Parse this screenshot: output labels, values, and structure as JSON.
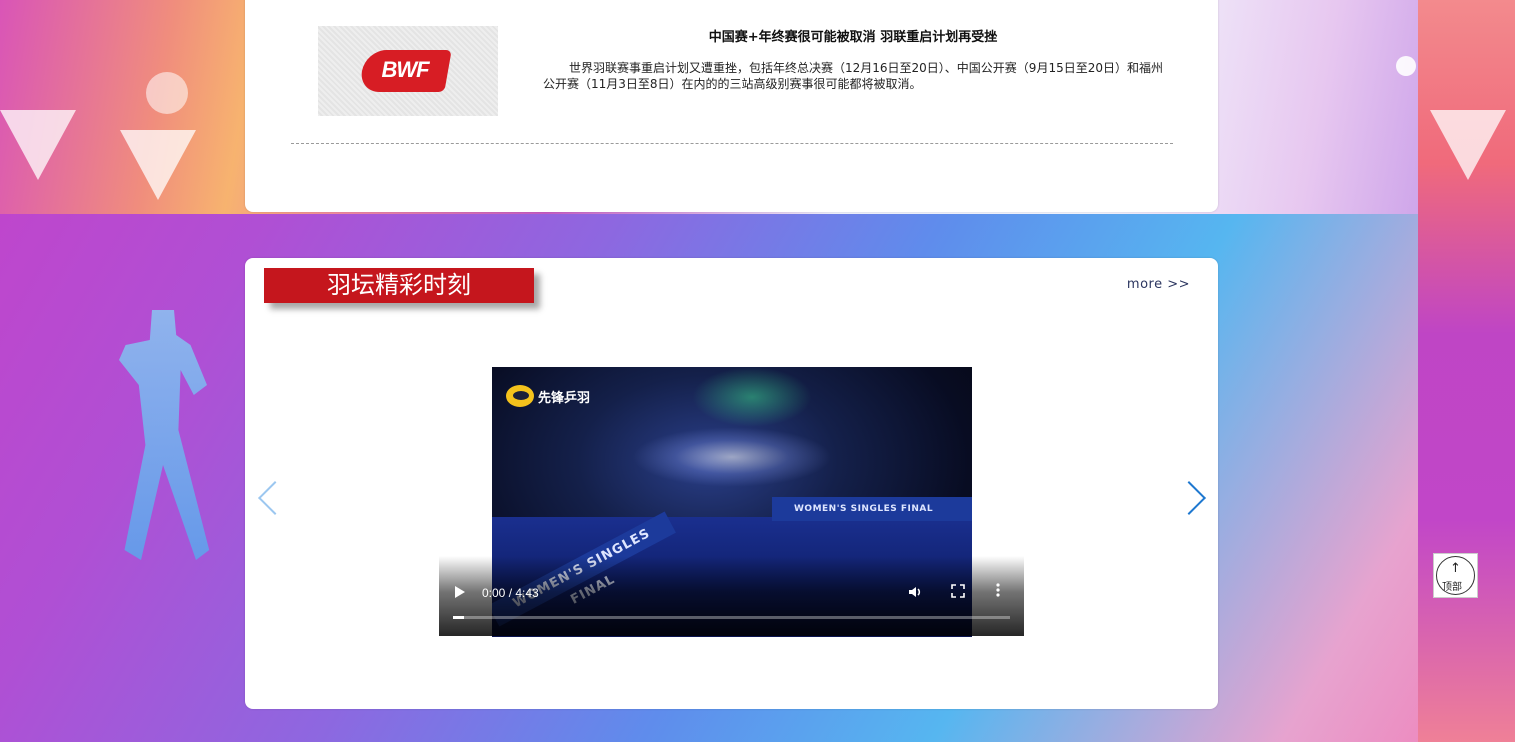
{
  "news": {
    "thumbnail_logo_text": "BWF",
    "title": "中国赛+年终赛很可能被取消 羽联重启计划再受挫",
    "summary": "世界羽联赛事重启计划又遭重挫，包括年终总决赛（12月16日至20日）、中国公开赛（9月15日至20日）和福州公开赛（11月3日至8日）在内的的三站高级别赛事很可能都将被取消。"
  },
  "highlights": {
    "section_title": "羽坛精彩时刻",
    "more_label": "more >>",
    "video": {
      "channel_name": "先锋乒羽",
      "banner_right": "WOMEN'S SINGLES FINAL",
      "banner_left": "WOMEN'S SINGLES FINAL",
      "time_display": "0:00 / 4:43",
      "progress": 0
    }
  },
  "back_to_top": {
    "arrow": "↑",
    "label": "顶部"
  },
  "icons": {
    "prev": "chevron-left-icon",
    "next": "chevron-right-icon",
    "volume": "volume-icon",
    "fullscreen": "fullscreen-icon",
    "more": "more-vertical-icon"
  }
}
